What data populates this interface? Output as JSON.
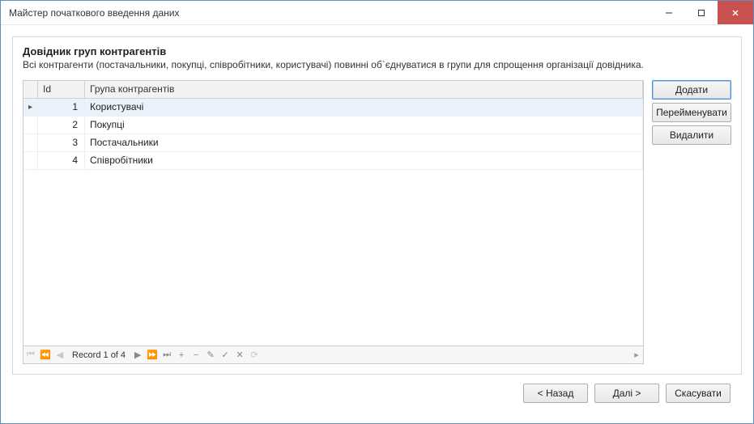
{
  "window": {
    "title": "Майстер початкового введення даних"
  },
  "panel": {
    "heading": "Довідник груп контрагентів",
    "subtext": "Всі контрагенти (постачальники, покупці, співробітники, користувачі) повинні об`єднуватися в групи для спрощення організації довідника."
  },
  "grid": {
    "columns": {
      "id": "Id",
      "group": "Група контрагентів"
    },
    "rows": [
      {
        "id": "1",
        "group": "Користувачі",
        "selected": true
      },
      {
        "id": "2",
        "group": "Покупці",
        "selected": false
      },
      {
        "id": "3",
        "group": "Постачальники",
        "selected": false
      },
      {
        "id": "4",
        "group": "Співробітники",
        "selected": false
      }
    ],
    "navigator": {
      "record_text": "Record 1 of 4"
    }
  },
  "side_buttons": {
    "add": "Додати",
    "rename": "Перейменувати",
    "delete": "Видалити"
  },
  "footer": {
    "back": "< Назад",
    "next": "Далі >",
    "cancel": "Скасувати"
  }
}
